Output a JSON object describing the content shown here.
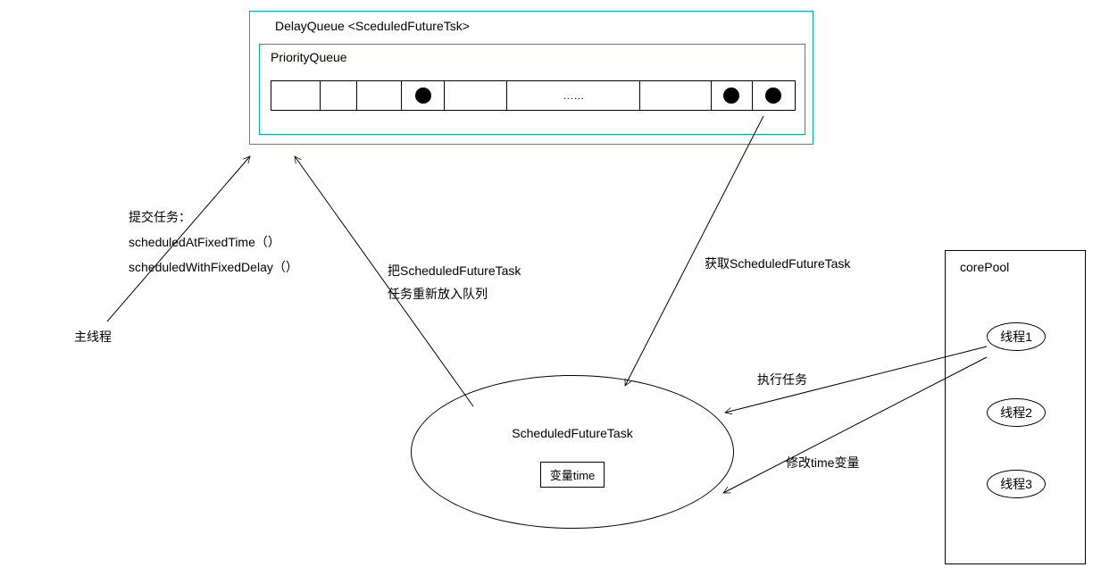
{
  "delayQueue": {
    "title": "DelayQueue   <SceduledFutureTsk>",
    "priorityQueueLabel": "PriorityQueue",
    "slotsDots": "……"
  },
  "mainThread": {
    "label": "主线程",
    "submitTitle": "提交任务：",
    "method1": "scheduledAtFixedTime（）",
    "method2": "scheduledWithFixedDelay（）"
  },
  "requeue": {
    "line1": "把ScheduledFutureTask",
    "line2": "任务重新放入队列"
  },
  "fetch": "获取ScheduledFutureTask",
  "execute": "执行任务",
  "modify": "修改time变量",
  "scheduledFutureTask": {
    "label": "ScheduledFutureTask",
    "varLabel": "变量time"
  },
  "corePool": {
    "title": "corePool",
    "thread1": "线程1",
    "thread2": "线程2",
    "thread3": "线程3"
  }
}
